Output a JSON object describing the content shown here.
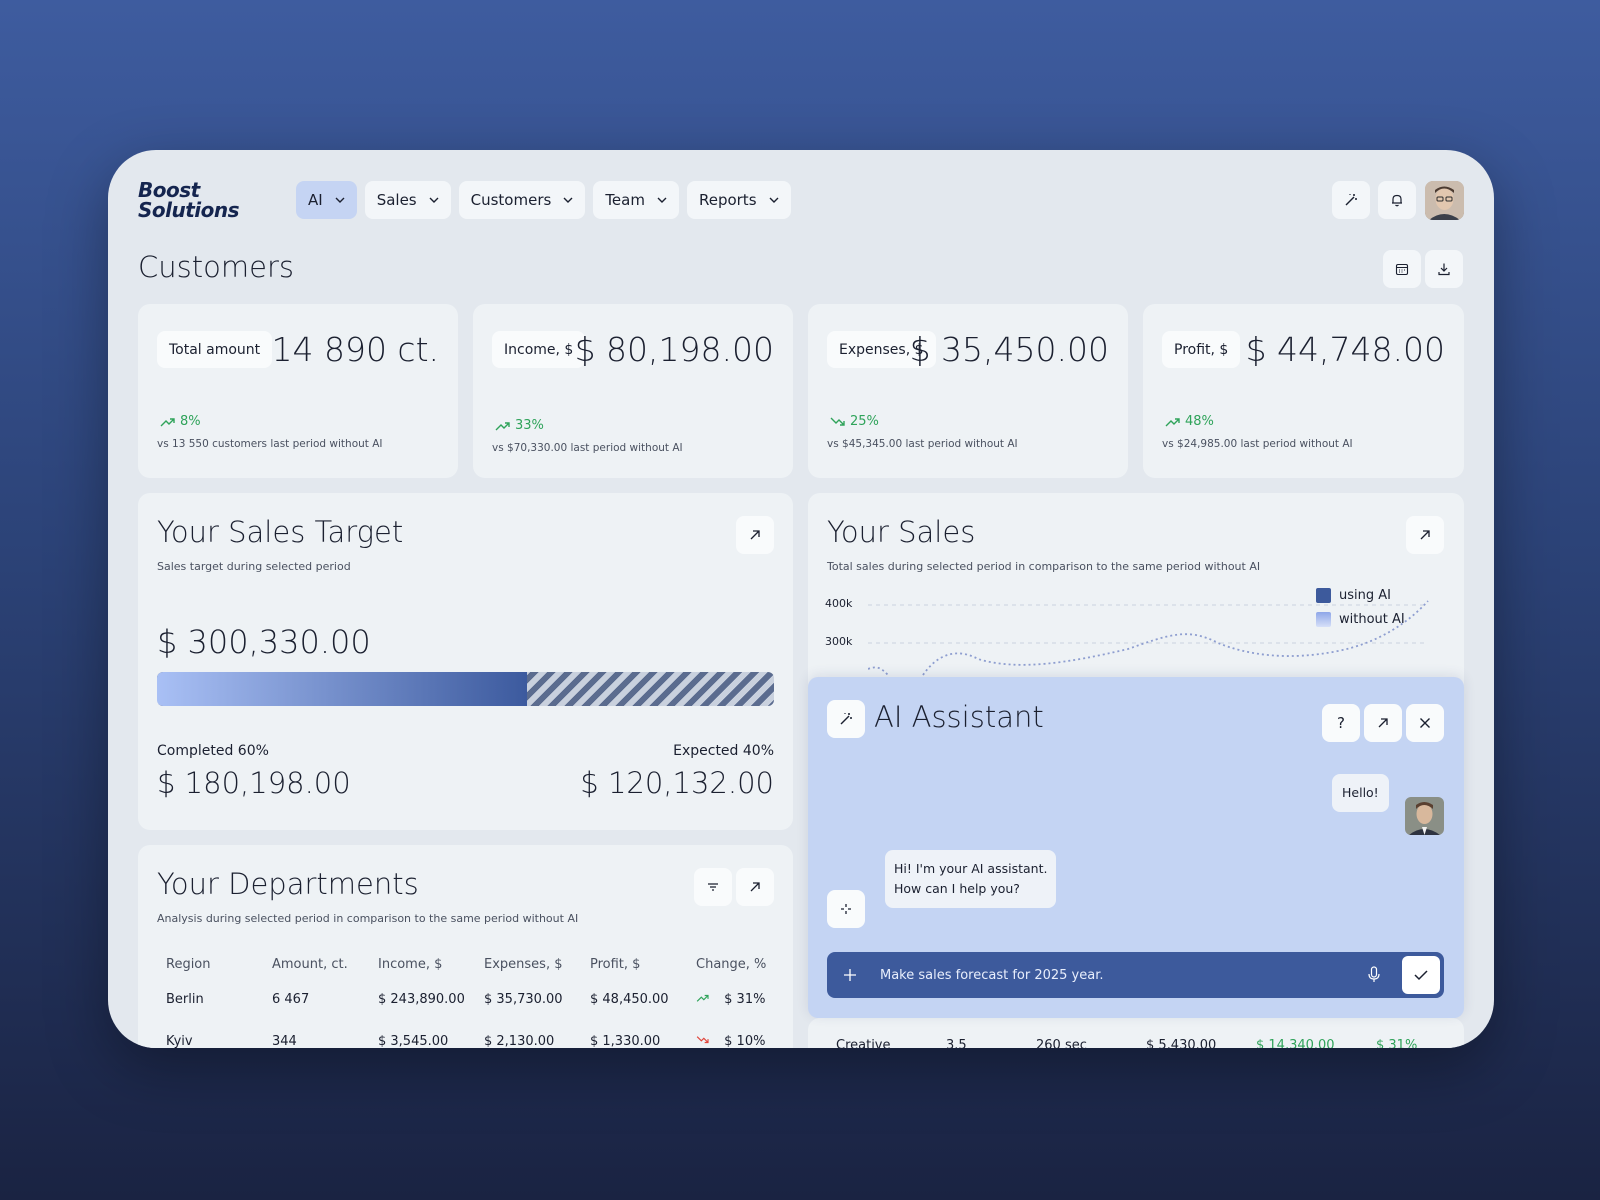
{
  "brand": {
    "line1": "Boost",
    "line2": "Solutions"
  },
  "nav": [
    {
      "label": "AI",
      "active": true
    },
    {
      "label": "Sales",
      "active": false
    },
    {
      "label": "Customers",
      "active": false
    },
    {
      "label": "Team",
      "active": false
    },
    {
      "label": "Reports",
      "active": false
    }
  ],
  "header_icons": [
    "magic-wand-icon",
    "bell-icon",
    "user-avatar"
  ],
  "page": {
    "title": "Customers",
    "actions": [
      "calendar-icon",
      "download-icon"
    ]
  },
  "kpis": [
    {
      "label": "Total amount",
      "value": "14 890 ct.",
      "change": "8%",
      "trend": "up",
      "note": "vs 13 550 customers last period without AI"
    },
    {
      "label": "Income, $",
      "value": "$ 80,198.00",
      "change": "33%",
      "trend": "up",
      "note": "vs $70,330.00 last period without AI"
    },
    {
      "label": "Expenses, $",
      "value": "$ 35,450.00",
      "change": "25%",
      "trend": "down",
      "note": "vs $45,345.00 last period without AI"
    },
    {
      "label": "Profit, $",
      "value": "$ 44,748.00",
      "change": "48%",
      "trend": "up",
      "note": "vs $24,985.00 last period without AI"
    }
  ],
  "sales_target": {
    "title": "Your Sales Target",
    "subtitle": "Sales target during selected period",
    "total": "$ 300,330.00",
    "completed_fraction": 0.6,
    "completed_label": "Completed 60%",
    "completed_value": "$ 180,198.00",
    "expected_label": "Expected 40%",
    "expected_value": "$ 120,132.00"
  },
  "sales": {
    "title": "Your Sales",
    "subtitle": "Total sales during selected period in comparison to the same period without AI",
    "legend": [
      "using AI",
      "without AI"
    ],
    "y_ticks": [
      "400k",
      "300k"
    ],
    "colors": {
      "using_ai": "#3d5a9c",
      "without_ai": "#a9bdf0"
    }
  },
  "departments": {
    "title": "Your Departments",
    "subtitle": "Analysis during selected period in comparison to the same period without  AI",
    "columns": [
      "Region",
      "Amount, ct.",
      "Income, $",
      "Expenses, $",
      "Profit, $",
      "Change, %"
    ],
    "rows": [
      {
        "region": "Berlin",
        "amount": "6 467",
        "income": "$ 243,890.00",
        "expenses": "$ 35,730.00",
        "profit": "$ 48,450.00",
        "change": "$ 31%",
        "trend": "up"
      },
      {
        "region": "Kyiv",
        "amount": "344",
        "income": "$ 3,545.00",
        "expenses": "$ 2,130.00",
        "profit": "$ 1,330.00",
        "change": "$ 10%",
        "trend": "down"
      }
    ],
    "partial_row_right": {
      "name": "Creative",
      "count": "3.5",
      "time": "260 sec",
      "income": "$ 5,430.00",
      "profit": "$ 14,340.00",
      "change": "$ 31%"
    }
  },
  "assistant": {
    "title": "AI Assistant",
    "user_message": "Hello!",
    "bot_message_line1": "Hi! I'm your AI assistant.",
    "bot_message_line2": "How can I help you?",
    "input_placeholder": "Make sales forecast for 2025 year.",
    "help_label": "?"
  }
}
